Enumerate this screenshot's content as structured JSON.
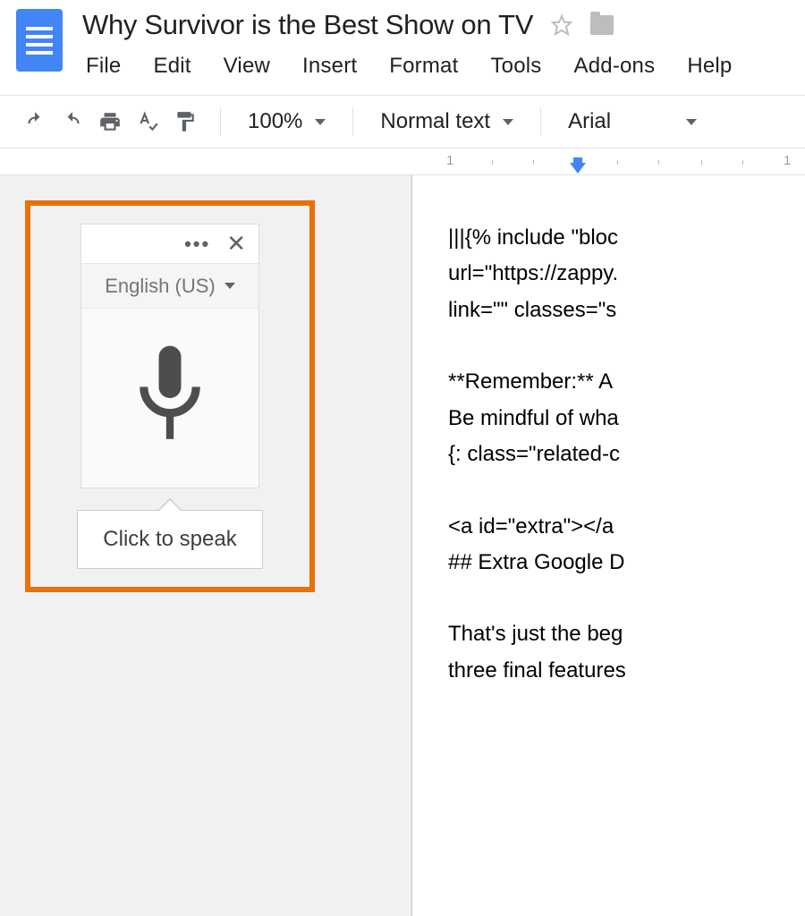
{
  "header": {
    "title": "Why Survivor is the Best Show on TV",
    "menu": {
      "file": "File",
      "edit": "Edit",
      "view": "View",
      "insert": "Insert",
      "format": "Format",
      "tools": "Tools",
      "addons": "Add-ons",
      "help": "Help"
    }
  },
  "toolbar": {
    "zoom": "100%",
    "style": "Normal text",
    "font": "Arial"
  },
  "ruler": {
    "mark1": "1",
    "mark2": "1"
  },
  "voice": {
    "language": "English (US)",
    "tooltip": "Click to speak",
    "more_dots": "•••"
  },
  "document": {
    "text": "|||{% include \"bloc\nurl=\"https://zappy.\nlink=\"\" classes=\"s\n\n**Remember:** A\nBe mindful of wha\n{: class=\"related-c\n\n<a id=\"extra\"></a\n## Extra Google D\n\nThat's just the beg\nthree final features"
  }
}
